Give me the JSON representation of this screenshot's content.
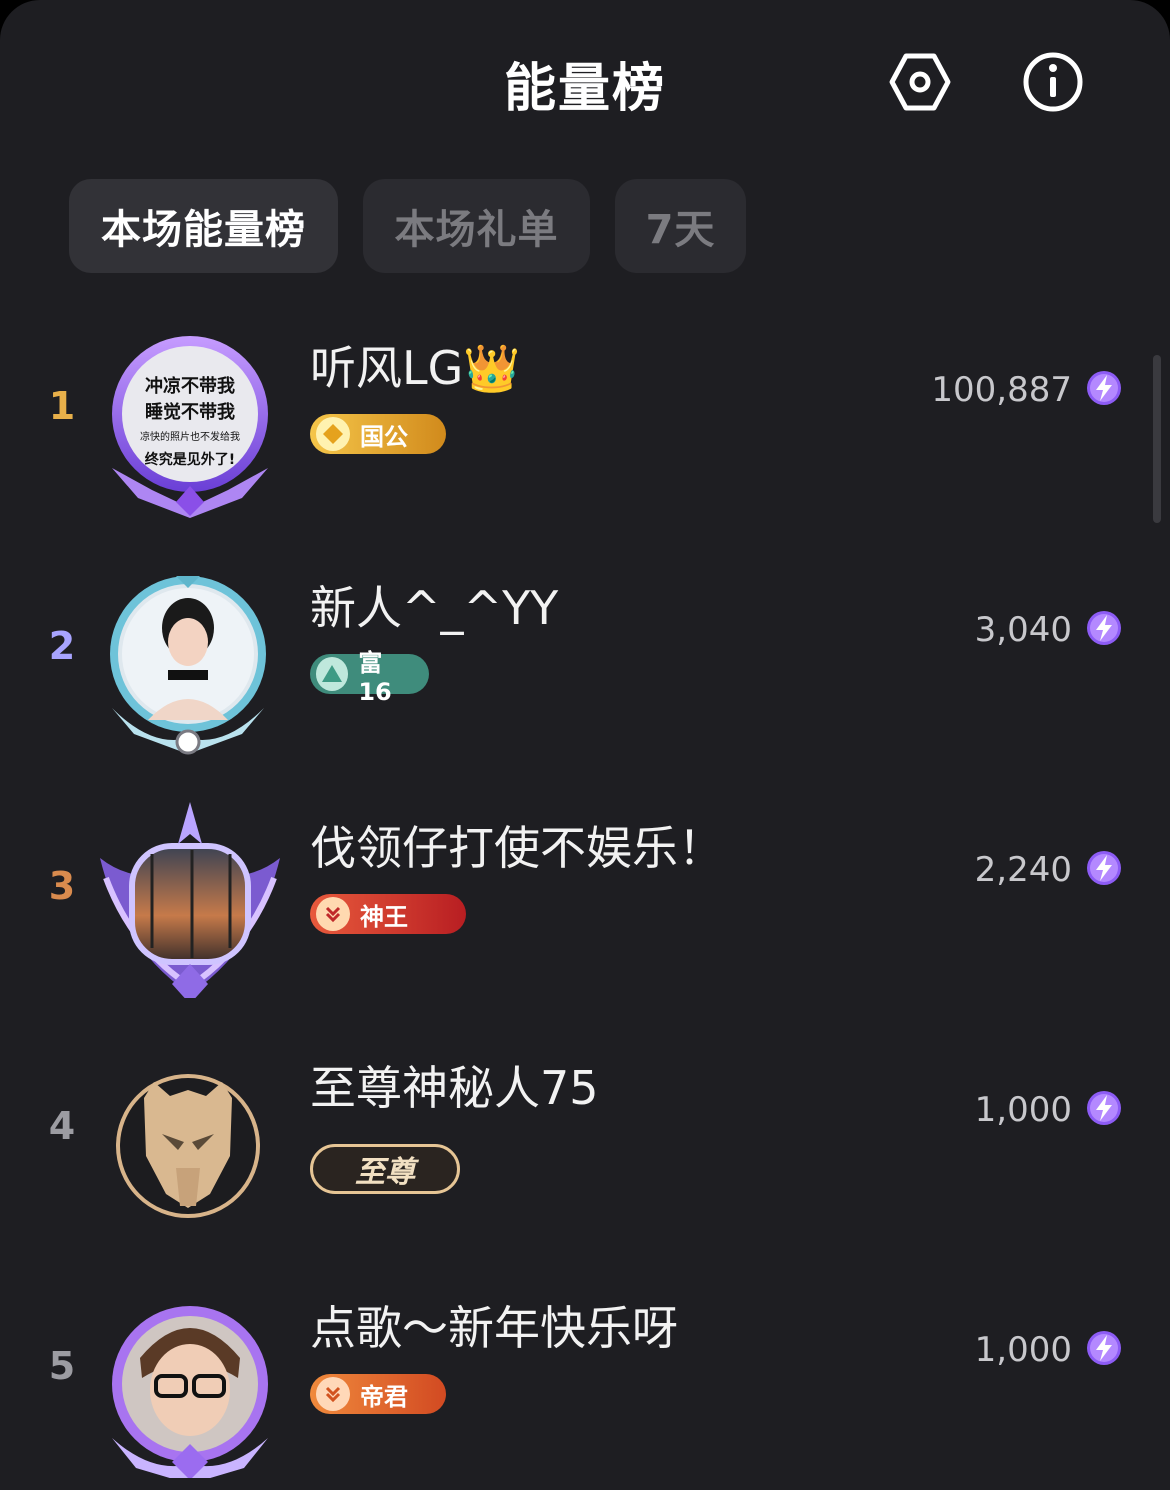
{
  "header": {
    "title": "能量榜",
    "settings_icon": "hexagon-settings-icon",
    "info_icon": "info-icon"
  },
  "tabs": [
    {
      "label": "本场能量榜",
      "active": true
    },
    {
      "label": "本场礼单",
      "active": false
    },
    {
      "label": "7天",
      "active": false
    }
  ],
  "rows": [
    {
      "rank": "1",
      "rank_color": "#e8b04a",
      "name": "听风LG👑",
      "badge": "国公",
      "badge_color": "#e0a52a",
      "score": "100,887",
      "avatar_text": [
        "冲凉不带我",
        "睡觉不带我",
        "凉快的照片也不发给我",
        "终究是见外了!"
      ]
    },
    {
      "rank": "2",
      "rank_color": "#a8a4ff",
      "name": "新人^_^YY",
      "badge": "富16",
      "badge_color": "#4fa894",
      "score": "3,040"
    },
    {
      "rank": "3",
      "rank_color": "#d98b4e",
      "name": "伐领仔打使不娱乐！",
      "badge": "神王",
      "badge_color": "#d7382e",
      "score": "2,240"
    },
    {
      "rank": "4",
      "rank_color": "#9c9ca2",
      "name": "至尊神秘人75",
      "badge": "至尊",
      "badge_color": "#e6c595",
      "score": "1,000"
    },
    {
      "rank": "5",
      "rank_color": "#9c9ca2",
      "name": "点歌～新年快乐呀",
      "badge": "帝君",
      "badge_color": "#e0642c",
      "score": "1,000"
    }
  ],
  "energy_icon": "lightning-bolt-icon",
  "colors": {
    "background": "#1e1e22",
    "energy_purple": "#a36bff"
  }
}
